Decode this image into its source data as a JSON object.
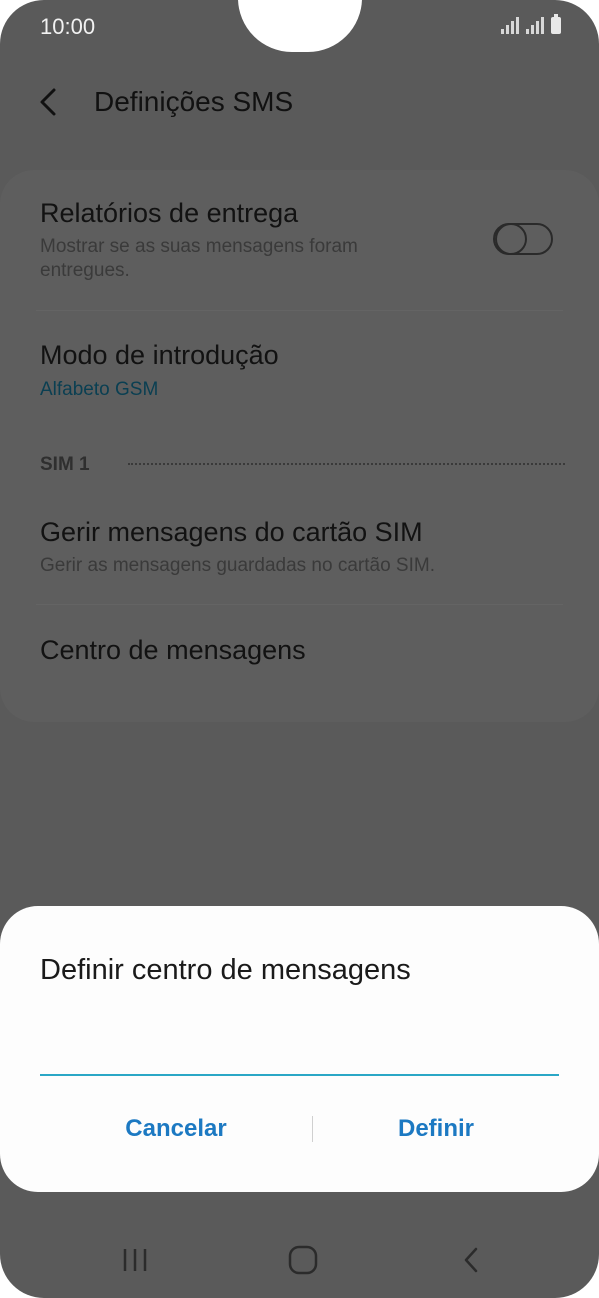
{
  "status_bar": {
    "time": "10:00"
  },
  "header": {
    "title": "Definições SMS"
  },
  "settings": {
    "delivery_reports": {
      "title": "Relatórios de entrega",
      "subtitle": "Mostrar se as suas mensagens foram entregues.",
      "toggle_on": false
    },
    "input_mode": {
      "title": "Modo de introdução",
      "value": "Alfabeto GSM"
    },
    "section_sim": "SIM 1",
    "manage_sim": {
      "title": "Gerir mensagens do cartão SIM",
      "subtitle": "Gerir as mensagens guardadas no cartão SIM."
    },
    "message_center": {
      "title": "Centro de mensagens"
    }
  },
  "dialog": {
    "title": "Definir centro de mensagens",
    "input_value": "",
    "cancel_label": "Cancelar",
    "confirm_label": "Definir"
  },
  "navbar": {
    "recents_icon": "recents-icon",
    "home_icon": "home-icon",
    "back_icon": "back-icon"
  },
  "colors": {
    "accent": "#1c79c2",
    "input_underline": "#2aa7c6",
    "scrim_background": "#5a5a5a",
    "dialog_background": "#fdfdfd"
  }
}
